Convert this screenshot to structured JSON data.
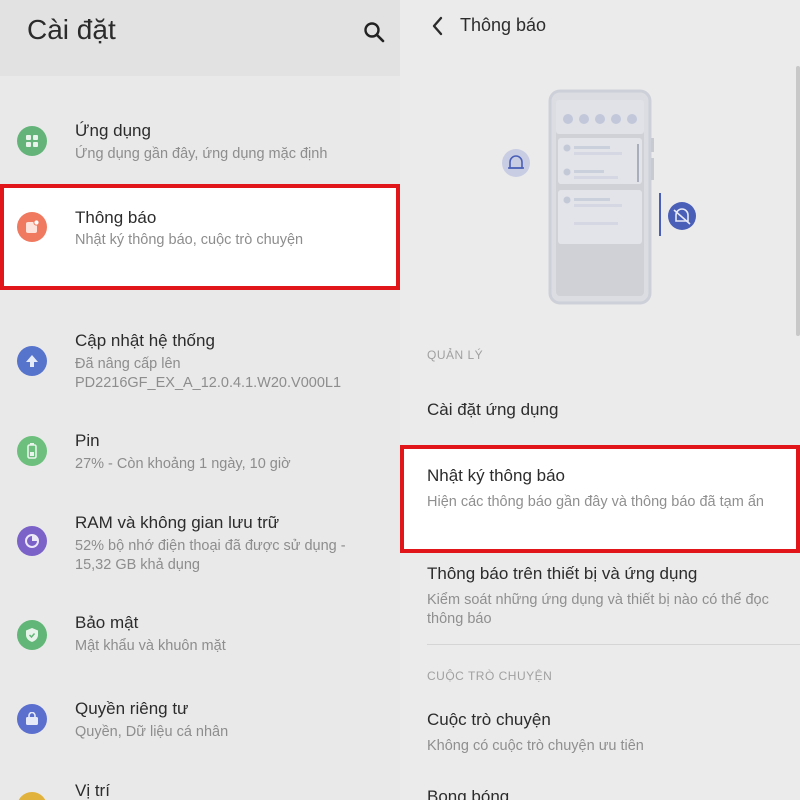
{
  "left": {
    "title": "Cài đặt",
    "items": [
      {
        "title": "Ứng dụng",
        "subtitle": "Ứng dụng gần đây, ứng dụng mặc định",
        "icon": "apps-icon",
        "color": "#64b47a"
      },
      {
        "title": "Thông báo",
        "subtitle": "Nhật ký thông báo, cuộc trò chuyện",
        "icon": "notification-icon",
        "color": "#f07a60"
      },
      {
        "title": "Cập nhật hệ thống",
        "subtitle": "Đã nâng cấp lên",
        "subtitle2": "PD2216GF_EX_A_12.0.4.1.W20.V000L1",
        "icon": "update-icon",
        "color": "#5774cc"
      },
      {
        "title": "Pin",
        "subtitle": "27% - Còn khoảng 1 ngày, 10 giờ",
        "icon": "battery-icon",
        "color": "#6cbf7c"
      },
      {
        "title": "RAM và không gian lưu trữ",
        "subtitle": "52% bộ nhớ điện thoại đã được sử dụng -",
        "subtitle2": "15,32 GB khả dụng",
        "icon": "storage-icon",
        "color": "#7a62c9"
      },
      {
        "title": "Bảo mật",
        "subtitle": "Mật khẩu và khuôn mặt",
        "icon": "shield-icon",
        "color": "#62b677"
      },
      {
        "title": "Quyền riêng tư",
        "subtitle": "Quyền, Dữ liệu cá nhân",
        "icon": "privacy-icon",
        "color": "#5b6fcf"
      },
      {
        "title": "Vị trí",
        "icon": "location-icon",
        "color": "#e2b33c"
      }
    ]
  },
  "right": {
    "title": "Thông báo",
    "section1": "QUẢN LÝ",
    "items1": [
      {
        "title": "Cài đặt ứng dụng"
      },
      {
        "title": "Nhật ký thông báo",
        "subtitle": "Hiện các thông báo gần đây và thông báo đã tạm ẩn"
      },
      {
        "title": "Thông báo trên thiết bị và ứng dụng",
        "subtitle": "Kiểm soát những ứng dụng và thiết bị nào có thể đọc thông báo"
      }
    ],
    "section2": "CUỘC TRÒ CHUYỆN",
    "items2": [
      {
        "title": "Cuộc trò chuyện",
        "subtitle": "Không có cuộc trò chuyện ưu tiên"
      },
      {
        "title": "Bong bóng"
      }
    ]
  },
  "colors": {
    "highlight": "#e0161b",
    "accent": "#4a5fb8"
  }
}
